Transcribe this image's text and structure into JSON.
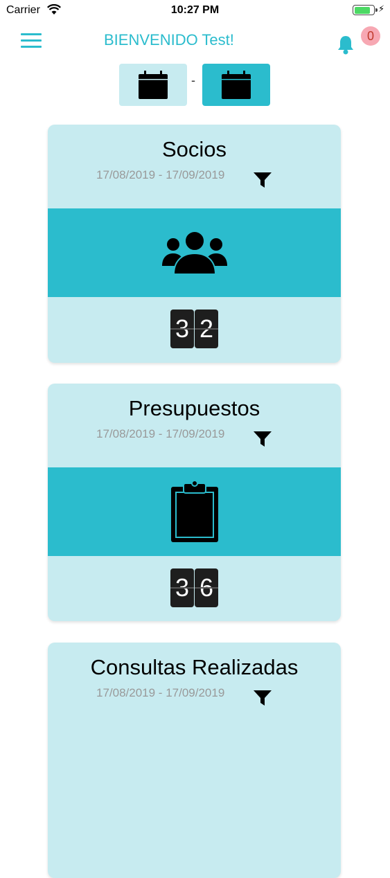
{
  "status_bar": {
    "carrier": "Carrier",
    "time": "10:27 PM",
    "battery_level": 0.85
  },
  "header": {
    "title": "BIENVENIDO Test!",
    "notification_count": "0"
  },
  "date_range": {
    "separator": "-"
  },
  "cards": [
    {
      "title": "Socios",
      "range": "17/08/2019 - 17/09/2019",
      "icon": "users-icon",
      "digits": [
        "3",
        "2"
      ]
    },
    {
      "title": "Presupuestos",
      "range": "17/08/2019 - 17/09/2019",
      "icon": "clipboard-icon",
      "digits": [
        "3",
        "6"
      ]
    },
    {
      "title": "Consultas Realizadas",
      "range": "17/08/2019 - 17/09/2019",
      "icon": "",
      "digits": []
    }
  ],
  "colors": {
    "accent": "#2bbccd",
    "card_bg": "#c7ebf0",
    "badge_bg": "#f7a8b3"
  }
}
